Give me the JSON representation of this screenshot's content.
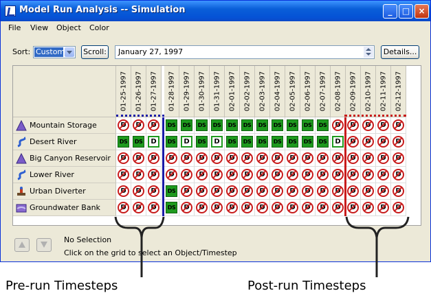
{
  "window": {
    "title": "Model Run Analysis -- Simulation",
    "controls": [
      "_",
      "□",
      "×"
    ]
  },
  "menu": [
    "File",
    "View",
    "Object",
    "Color"
  ],
  "toolbar": {
    "sort_label": "Sort:",
    "sort_value": "Custom",
    "scroll_button": "Scroll:",
    "date_value": "January 27, 1997",
    "details_button": "Details..."
  },
  "timesteps": [
    "01-25-1997",
    "01-26-1997",
    "01-27-1997",
    "01-28-1997",
    "01-29-1997",
    "01-30-1997",
    "01-31-1997",
    "02-01-1997",
    "02-02-1997",
    "02-03-1997",
    "02-04-1997",
    "02-05-1997",
    "02-06-1997",
    "02-07-1997",
    "02-08-1997",
    "02-09-1997",
    "02-10-1997",
    "02-11-1997",
    "02-12-1997"
  ],
  "objects": [
    {
      "name": "Mountain Storage",
      "icon": "reservoir-icon",
      "cells": [
        "D",
        "D",
        "D",
        "DS",
        "DS",
        "DS",
        "DS",
        "DS",
        "DS",
        "DS",
        "DS",
        "DS",
        "DS",
        "DS",
        "D",
        "D",
        "D",
        "D",
        "D"
      ]
    },
    {
      "name": "Desert River",
      "icon": "river-icon",
      "cells": [
        "DS",
        "DS",
        "Dg",
        "DS",
        "Dg",
        "DS",
        "Dg",
        "DS",
        "DS",
        "DS",
        "DS",
        "DS",
        "DS",
        "DS",
        "Dg",
        "D",
        "D",
        "D",
        "D"
      ]
    },
    {
      "name": "Big Canyon Reservoir",
      "icon": "reservoir-icon",
      "cells": [
        "D",
        "D",
        "D",
        "D",
        "D",
        "D",
        "D",
        "D",
        "D",
        "D",
        "D",
        "D",
        "D",
        "D",
        "D",
        "D",
        "D",
        "D",
        "D"
      ]
    },
    {
      "name": "Lower River",
      "icon": "river-icon",
      "cells": [
        "D",
        "D",
        "D",
        "D",
        "D",
        "D",
        "D",
        "D",
        "D",
        "D",
        "D",
        "D",
        "D",
        "D",
        "D",
        "D",
        "D",
        "D",
        "D"
      ]
    },
    {
      "name": "Urban Diverter",
      "icon": "diversion-icon",
      "cells": [
        "D",
        "D",
        "D",
        "DS",
        "D",
        "D",
        "D",
        "D",
        "D",
        "D",
        "D",
        "D",
        "D",
        "D",
        "D",
        "D",
        "D",
        "D",
        "D"
      ]
    },
    {
      "name": "Groundwater Bank",
      "icon": "groundwater-icon",
      "cells": [
        "D",
        "D",
        "D",
        "DS",
        "D",
        "D",
        "D",
        "D",
        "D",
        "D",
        "D",
        "D",
        "D",
        "D",
        "D",
        "D",
        "D",
        "D",
        "D"
      ]
    }
  ],
  "status": {
    "selection": "No Selection",
    "hint": "Click on the grid to select an Object/Timestep"
  },
  "annotations": {
    "pre_run": "Pre-run Timesteps",
    "post_run": "Post-run Timesteps"
  },
  "colors": {
    "pre_run_marker": "#1a1aa8",
    "post_run_marker": "#c81c1c",
    "solved_cell": "#1e9a1e"
  }
}
